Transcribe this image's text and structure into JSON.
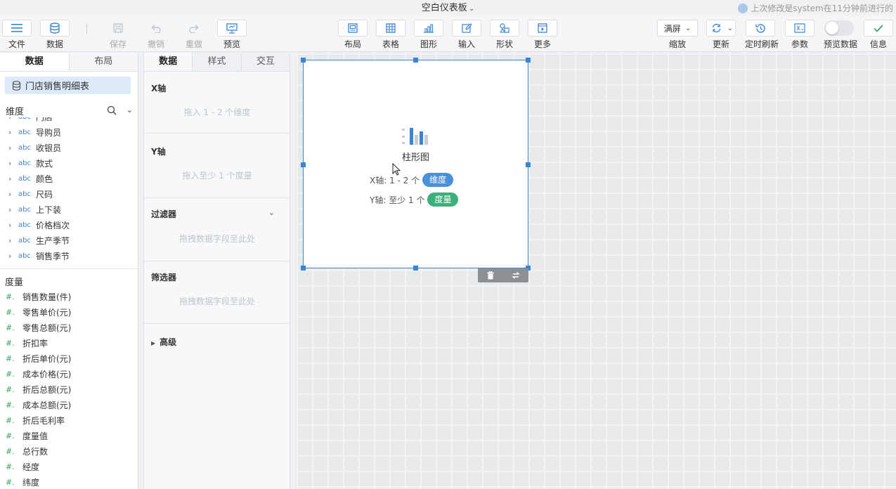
{
  "header": {
    "title": "空白仪表板",
    "last_modified": "上次修改是system在11分钟前进行的"
  },
  "toolbar": {
    "file": "文件",
    "data": "数据",
    "save": "保存",
    "undo": "撤销",
    "redo": "重做",
    "preview": "预览",
    "layout": "布局",
    "table": "表格",
    "chart": "图形",
    "input": "输入",
    "shape": "形状",
    "more": "更多",
    "zoom_value": "满屏",
    "zoom": "缩放",
    "refresh": "更新",
    "timed_refresh": "定时刷新",
    "params": "参数",
    "preview_data": "预览数据",
    "info": "信息"
  },
  "left_panel": {
    "tab_data": "数据",
    "tab_layout": "布局",
    "dataset": "门店销售明细表",
    "dimensions_label": "维度",
    "dimension_type": "abc",
    "dimensions": [
      "门店",
      "导购员",
      "收银员",
      "款式",
      "颜色",
      "尺码",
      "上下装",
      "价格档次",
      "生产季节",
      "销售季节"
    ],
    "measures_label": "度量",
    "measure_type": "#.",
    "measures": [
      "销售数量(件)",
      "零售单价(元)",
      "零售总额(元)",
      "折扣率",
      "折后单价(元)",
      "成本价格(元)",
      "折后总额(元)",
      "成本总额(元)",
      "折后毛利率",
      "度量值",
      "总行数",
      "经度",
      "纬度"
    ]
  },
  "config_panel": {
    "tab_data": "数据",
    "tab_style": "样式",
    "tab_interact": "交互",
    "x_axis": "X轴",
    "x_axis_hint": "拖入 1 - 2 个维度",
    "y_axis": "Y轴",
    "y_axis_hint": "拖入至少 1 个度量",
    "filter": "过滤器",
    "filter_hint": "拖拽数据字段至此处",
    "selector": "筛选器",
    "selector_hint": "拖拽数据字段至此处",
    "advanced": "高级"
  },
  "widget": {
    "chart_name": "柱形图",
    "x_req": "X轴: 1 - 2 个",
    "x_pill": "维度",
    "y_req": "Y轴: 至少 1 个",
    "y_pill": "度量"
  },
  "colors": {
    "accent": "#3a84d8",
    "dimension_pill": "#4a90d9",
    "measure_pill": "#3db07a"
  }
}
